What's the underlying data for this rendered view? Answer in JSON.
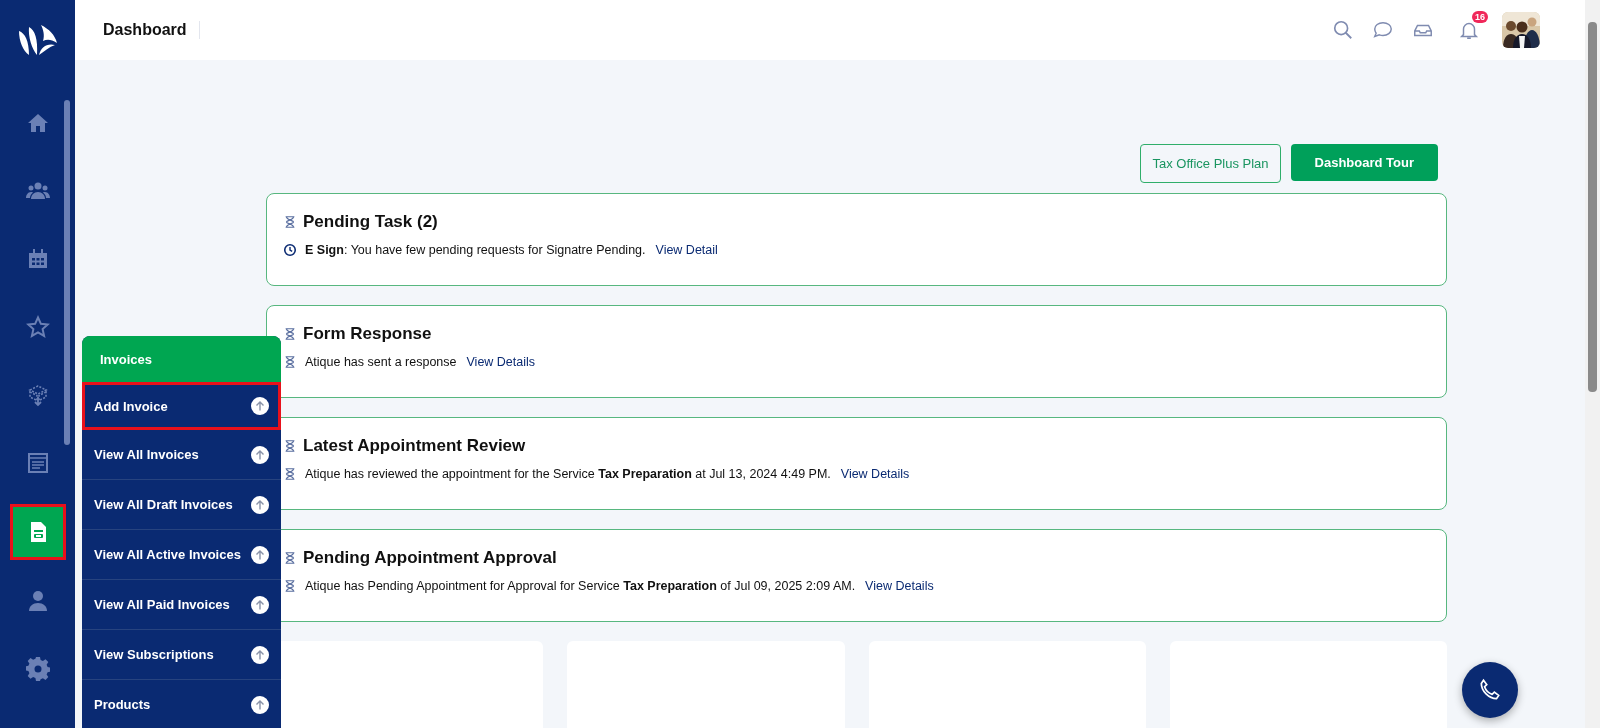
{
  "header": {
    "title": "Dashboard",
    "notification_count": "16"
  },
  "sidebar": {
    "items": [
      {
        "kind": "home",
        "selected": false
      },
      {
        "kind": "users",
        "selected": false
      },
      {
        "kind": "calendar",
        "selected": false
      },
      {
        "kind": "star",
        "selected": false
      },
      {
        "kind": "box",
        "selected": false
      },
      {
        "kind": "board",
        "selected": false
      },
      {
        "kind": "invoice",
        "selected": true
      },
      {
        "kind": "user",
        "selected": false
      },
      {
        "kind": "gear",
        "selected": false
      }
    ]
  },
  "invoice_menu": {
    "title": "Invoices",
    "items": [
      {
        "label": "Add Invoice",
        "selected": true
      },
      {
        "label": "View All Invoices",
        "selected": false
      },
      {
        "label": "View All Draft Invoices",
        "selected": false
      },
      {
        "label": "View All Active Invoices",
        "selected": false
      },
      {
        "label": "View All Paid Invoices",
        "selected": false
      },
      {
        "label": "View Subscriptions",
        "selected": false
      },
      {
        "label": "Products",
        "selected": false
      }
    ]
  },
  "actions": [
    {
      "label": "Tax Office Plus Plan",
      "kind": "outline"
    },
    {
      "label": "Dashboard Tour",
      "kind": "solid"
    }
  ],
  "cards": [
    {
      "title": "Pending Task (2)",
      "kind": "clock",
      "text": "**E Sign**: You have few pending requests for Signatre Pending.",
      "link": "View Detail"
    },
    {
      "title": "Form Response",
      "kind": "hourglass",
      "text": "Atique has sent a response",
      "link": "View Details"
    },
    {
      "title": "Latest Appointment Review",
      "kind": "hourglass",
      "text": "Atique has reviewed the appointment for the Service **Tax Preparation** at Jul 13, 2024 4:49 PM.",
      "link": "View Details"
    },
    {
      "title": "Pending Appointment Approval",
      "kind": "hourglass",
      "text": "Atique has Pending Appointment for Approval for Service **Tax Preparation** of Jul 09, 2025 2:09 AM.",
      "link": "View Details"
    }
  ],
  "blank_cards": [
    {
      "kind": "blank"
    },
    {
      "kind": "blank"
    },
    {
      "kind": "blank"
    },
    {
      "kind": "blank"
    }
  ]
}
